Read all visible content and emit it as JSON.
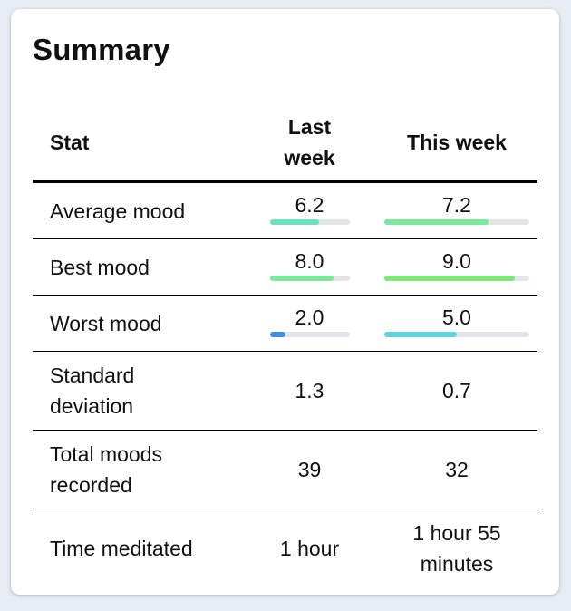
{
  "title": "Summary",
  "columns": {
    "stat": "Stat",
    "last_week": "Last week",
    "this_week": "This week"
  },
  "rows": [
    {
      "label": "Average mood",
      "last": "6.2",
      "this": "7.2",
      "last_fraction": 0.62,
      "this_fraction": 0.72,
      "last_color": "#6ee0be",
      "this_color": "#7ce89e"
    },
    {
      "label": "Best mood",
      "last": "8.0",
      "this": "9.0",
      "last_fraction": 0.8,
      "this_fraction": 0.9,
      "last_color": "#7ce89e",
      "this_color": "#7fe87a"
    },
    {
      "label": "Worst mood",
      "last": "2.0",
      "this": "5.0",
      "last_fraction": 0.2,
      "this_fraction": 0.5,
      "last_color": "#3d8ee8",
      "this_color": "#5ed4dc"
    },
    {
      "label": "Standard deviation",
      "last": "1.3",
      "this": "0.7"
    },
    {
      "label": "Total moods recorded",
      "last": "39",
      "this": "32"
    },
    {
      "label": "Time meditated",
      "last": "1 hour",
      "this": "1 hour 55 minutes"
    }
  ]
}
